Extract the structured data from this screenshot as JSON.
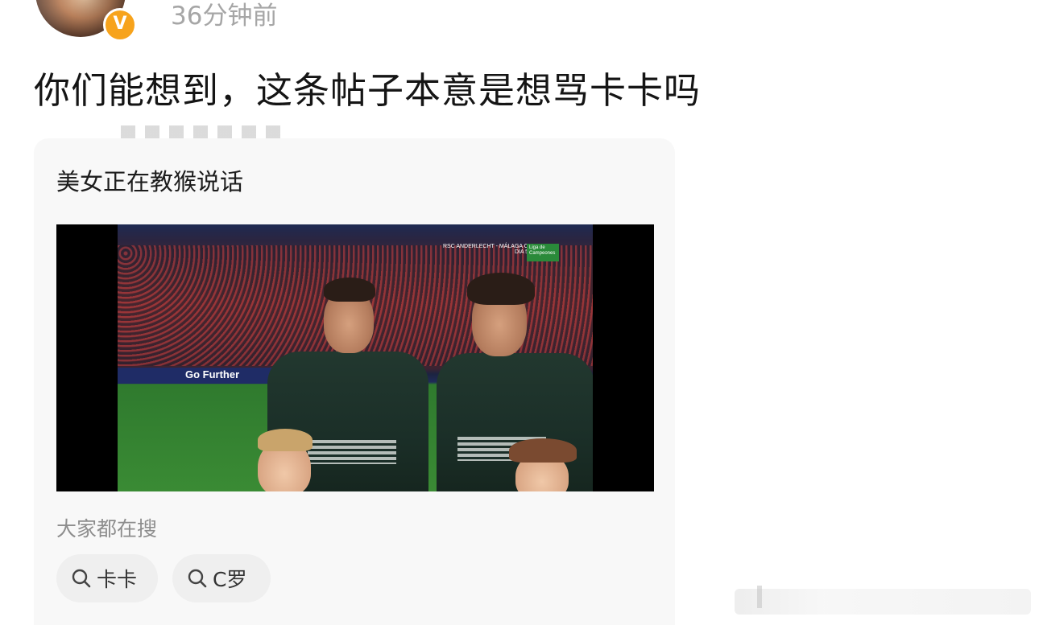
{
  "post": {
    "timestamp": "36分钟前",
    "text": "你们能想到，这条帖子本意是想骂卡卡吗",
    "verified_badge": "V"
  },
  "card": {
    "title": "美女正在教猴说话",
    "video": {
      "ad_text": "Go Further",
      "overlay_match": "RSC ANDERLECHT - MÁLAGA CF",
      "overlay_day": "DIA 58",
      "overlay_badge": "Liga de Campeones"
    },
    "search_label": "大家都在搜",
    "search_chips": [
      {
        "label": "卡卡"
      },
      {
        "label": "C罗"
      }
    ]
  },
  "colors": {
    "badge": "#f7a31c",
    "timestamp": "#a6a6a6",
    "card_bg": "#f8f8f8",
    "chip_bg": "#efefef"
  },
  "icons": {
    "verified": "verified-v-badge-icon",
    "search": "search-icon"
  }
}
